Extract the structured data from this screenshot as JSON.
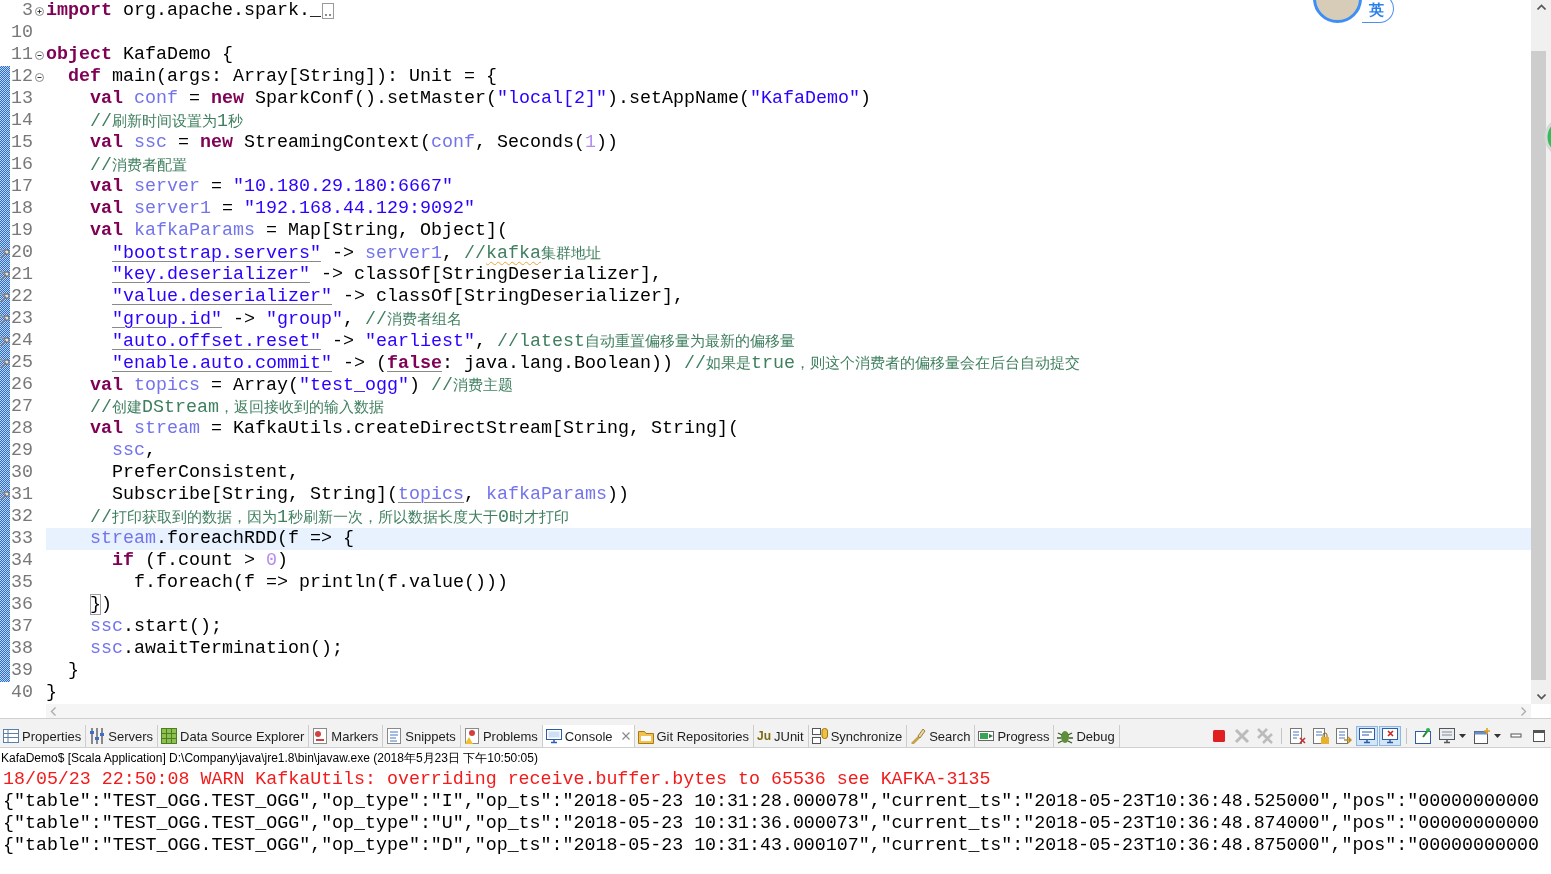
{
  "editor": {
    "lines": [
      {
        "number": "3",
        "foldable": true,
        "collapsed": true,
        "changed": false,
        "marker": false,
        "current": false,
        "tokens": [
          {
            "kind": "keyword",
            "text": "import"
          },
          {
            "kind": "plain",
            "text": " org.apache.spark._"
          }
        ]
      },
      {
        "number": "10",
        "foldable": false,
        "collapsed": false,
        "changed": false,
        "marker": false,
        "current": false
      },
      {
        "number": "11",
        "foldable": true,
        "collapsed": false,
        "changed": false,
        "marker": false,
        "current": false,
        "tokens": [
          {
            "kind": "keyword",
            "text": "object"
          },
          {
            "kind": "plain",
            "text": " KafaDemo {"
          }
        ]
      },
      {
        "number": "12",
        "foldable": true,
        "collapsed": false,
        "changed": true,
        "marker": false,
        "current": false,
        "tokens": [
          {
            "kind": "keyword",
            "text": "  def"
          },
          {
            "kind": "plain",
            "text": " main(args: Array[String]): Unit = {"
          }
        ]
      },
      {
        "number": "13",
        "foldable": false,
        "collapsed": false,
        "changed": true,
        "marker": false,
        "current": false,
        "tokens": [
          {
            "kind": "keyword",
            "text": "    val "
          },
          {
            "kind": "field",
            "text": "conf"
          },
          {
            "kind": "plain",
            "text": " = "
          },
          {
            "kind": "keyword",
            "text": "new"
          },
          {
            "kind": "plain",
            "text": " SparkConf().setMaster("
          },
          {
            "kind": "string",
            "text": "\"local[2]\""
          },
          {
            "kind": "plain",
            "text": ").setAppName("
          },
          {
            "kind": "string",
            "text": "\"KafaDemo\""
          },
          {
            "kind": "plain",
            "text": ")"
          }
        ]
      },
      {
        "number": "14",
        "foldable": false,
        "collapsed": false,
        "changed": true,
        "marker": false,
        "current": false,
        "tokens": [
          {
            "kind": "comment",
            "text": "    //刷新时间设置为1秒"
          }
        ]
      },
      {
        "number": "15",
        "foldable": false,
        "collapsed": false,
        "changed": true,
        "marker": false,
        "current": false,
        "tokens": [
          {
            "kind": "keyword",
            "text": "    val "
          },
          {
            "kind": "field",
            "text": "ssc"
          },
          {
            "kind": "plain",
            "text": " = "
          },
          {
            "kind": "keyword",
            "text": "new"
          },
          {
            "kind": "plain",
            "text": " StreamingContext("
          },
          {
            "kind": "field",
            "text": "conf"
          },
          {
            "kind": "plain",
            "text": ", Seconds("
          },
          {
            "kind": "number",
            "text": "1"
          },
          {
            "kind": "plain",
            "text": "))"
          }
        ]
      },
      {
        "number": "16",
        "foldable": false,
        "collapsed": false,
        "changed": true,
        "marker": false,
        "current": false,
        "tokens": [
          {
            "kind": "comment",
            "text": "    //消费者配置"
          }
        ]
      },
      {
        "number": "17",
        "foldable": false,
        "collapsed": false,
        "changed": true,
        "marker": false,
        "current": false,
        "tokens": [
          {
            "kind": "keyword",
            "text": "    val "
          },
          {
            "kind": "field",
            "text": "server"
          },
          {
            "kind": "plain",
            "text": " = "
          },
          {
            "kind": "string",
            "text": "\"10.180.29.180:6667\""
          }
        ]
      },
      {
        "number": "18",
        "foldable": false,
        "collapsed": false,
        "changed": true,
        "marker": false,
        "current": false,
        "tokens": [
          {
            "kind": "keyword",
            "text": "    val "
          },
          {
            "kind": "field",
            "text": "server1"
          },
          {
            "kind": "plain",
            "text": " = "
          },
          {
            "kind": "string",
            "text": "\"192.168.44.129:9092\""
          }
        ]
      },
      {
        "number": "19",
        "foldable": false,
        "collapsed": false,
        "changed": true,
        "marker": false,
        "current": false,
        "tokens": [
          {
            "kind": "keyword",
            "text": "    val "
          },
          {
            "kind": "field",
            "text": "kafkaParams"
          },
          {
            "kind": "plain",
            "text": " = Map[String, Object]("
          }
        ]
      },
      {
        "number": "20",
        "foldable": false,
        "collapsed": false,
        "changed": true,
        "marker": true,
        "current": false,
        "tokens": [
          {
            "kind": "implicit",
            "tokens": [
              {
                "kind": "string",
                "text": "      \"bootstrap.servers\""
              }
            ]
          },
          {
            "kind": "plain",
            "text": " -> "
          },
          {
            "kind": "field",
            "text": "server1"
          },
          {
            "kind": "plain",
            "text": ", "
          },
          {
            "kind": "comment",
            "text": "//"
          },
          {
            "kind": "misspelled",
            "tokens": [
              {
                "kind": "comment",
                "text": "kafka"
              }
            ]
          },
          {
            "kind": "comment",
            "text": "集群地址"
          }
        ]
      },
      {
        "number": "21",
        "foldable": false,
        "collapsed": false,
        "changed": true,
        "marker": true,
        "current": false,
        "tokens": [
          {
            "kind": "implicit",
            "tokens": [
              {
                "kind": "string",
                "text": "      \"key.deserializer\""
              }
            ]
          },
          {
            "kind": "plain",
            "text": " -> classOf[StringDeserializer],"
          }
        ]
      },
      {
        "number": "22",
        "foldable": false,
        "collapsed": false,
        "changed": true,
        "marker": true,
        "current": false,
        "tokens": [
          {
            "kind": "implicit",
            "tokens": [
              {
                "kind": "string",
                "text": "      \"value.deserializer\""
              }
            ]
          },
          {
            "kind": "plain",
            "text": " -> classOf[StringDeserializer],"
          }
        ]
      },
      {
        "number": "23",
        "foldable": false,
        "collapsed": false,
        "changed": true,
        "marker": true,
        "current": false,
        "tokens": [
          {
            "kind": "implicit",
            "tokens": [
              {
                "kind": "string",
                "text": "      \"group.id\""
              }
            ]
          },
          {
            "kind": "plain",
            "text": " -> "
          },
          {
            "kind": "string",
            "text": "\"group\""
          },
          {
            "kind": "plain",
            "text": ", "
          },
          {
            "kind": "comment",
            "text": "//消费者组名"
          }
        ]
      },
      {
        "number": "24",
        "foldable": false,
        "collapsed": false,
        "changed": true,
        "marker": true,
        "current": false,
        "tokens": [
          {
            "kind": "implicit",
            "tokens": [
              {
                "kind": "string",
                "text": "      \"auto.offset.reset\""
              }
            ]
          },
          {
            "kind": "plain",
            "text": " -> "
          },
          {
            "kind": "string",
            "text": "\"earliest\""
          },
          {
            "kind": "plain",
            "text": ", "
          },
          {
            "kind": "comment",
            "text": "//latest自动重置偏移量为最新的偏移量"
          }
        ]
      },
      {
        "number": "25",
        "foldable": false,
        "collapsed": false,
        "changed": true,
        "marker": true,
        "current": false,
        "tokens": [
          {
            "kind": "implicit",
            "tokens": [
              {
                "kind": "string",
                "text": "      \"enable.auto.commit\""
              }
            ]
          },
          {
            "kind": "plain",
            "text": " -> ("
          },
          {
            "kind": "implicit",
            "tokens": [
              {
                "kind": "keyword",
                "text": "false"
              }
            ]
          },
          {
            "kind": "plain",
            "text": ": java.lang.Boolean)) "
          },
          {
            "kind": "comment",
            "text": "//如果是true，则这个消费者的偏移量会在后台自动提交"
          }
        ]
      },
      {
        "number": "26",
        "foldable": false,
        "collapsed": false,
        "changed": true,
        "marker": false,
        "current": false,
        "tokens": [
          {
            "kind": "keyword",
            "text": "    val "
          },
          {
            "kind": "field",
            "text": "topics"
          },
          {
            "kind": "plain",
            "text": " = Array("
          },
          {
            "kind": "string",
            "text": "\"test_ogg\""
          },
          {
            "kind": "plain",
            "text": ") "
          },
          {
            "kind": "comment",
            "text": "//消费主题"
          }
        ]
      },
      {
        "number": "27",
        "foldable": false,
        "collapsed": false,
        "changed": true,
        "marker": false,
        "current": false,
        "tokens": [
          {
            "kind": "comment",
            "text": "    //创建DStream，返回接收到的输入数据"
          }
        ]
      },
      {
        "number": "28",
        "foldable": false,
        "collapsed": false,
        "changed": true,
        "marker": false,
        "current": false,
        "tokens": [
          {
            "kind": "keyword",
            "text": "    val "
          },
          {
            "kind": "field",
            "text": "stream"
          },
          {
            "kind": "plain",
            "text": " = KafkaUtils.createDirectStream[String, String]("
          }
        ]
      },
      {
        "number": "29",
        "foldable": false,
        "collapsed": false,
        "changed": true,
        "marker": false,
        "current": false,
        "tokens": [
          {
            "kind": "field",
            "text": "      ssc"
          },
          {
            "kind": "plain",
            "text": ","
          }
        ]
      },
      {
        "number": "30",
        "foldable": false,
        "collapsed": false,
        "changed": true,
        "marker": false,
        "current": false,
        "tokens": [
          {
            "kind": "plain",
            "text": "      PreferConsistent,"
          }
        ]
      },
      {
        "number": "31",
        "foldable": false,
        "collapsed": false,
        "changed": true,
        "marker": true,
        "current": false,
        "tokens": [
          {
            "kind": "plain",
            "text": "      Subscribe[String, String]("
          },
          {
            "kind": "implicit",
            "tokens": [
              {
                "kind": "field",
                "text": "topics"
              }
            ]
          },
          {
            "kind": "plain",
            "text": ", "
          },
          {
            "kind": "field",
            "text": "kafkaParams"
          },
          {
            "kind": "plain",
            "text": "))"
          }
        ]
      },
      {
        "number": "32",
        "foldable": false,
        "collapsed": false,
        "changed": true,
        "marker": false,
        "current": false,
        "tokens": [
          {
            "kind": "comment",
            "text": "    //打印获取到的数据，因为1秒刷新一次，所以数据长度大于0时才打印"
          }
        ]
      },
      {
        "number": "33",
        "foldable": false,
        "collapsed": false,
        "changed": true,
        "marker": false,
        "current": true,
        "tokens": [
          {
            "kind": "field",
            "text": "    stream"
          },
          {
            "kind": "plain",
            "text": ".foreachRDD(f => {"
          }
        ]
      },
      {
        "number": "34",
        "foldable": false,
        "collapsed": false,
        "changed": true,
        "marker": false,
        "current": false,
        "tokens": [
          {
            "kind": "keyword",
            "text": "      if"
          },
          {
            "kind": "plain",
            "text": " (f.count > "
          },
          {
            "kind": "number",
            "text": "0"
          },
          {
            "kind": "plain",
            "text": ")"
          }
        ]
      },
      {
        "number": "35",
        "foldable": false,
        "collapsed": false,
        "changed": true,
        "marker": false,
        "current": false,
        "tokens": [
          {
            "kind": "plain",
            "text": "        f.foreach(f => println(f.value()))"
          }
        ]
      },
      {
        "number": "36",
        "foldable": false,
        "collapsed": false,
        "changed": true,
        "marker": false,
        "current": false,
        "tokens": [
          {
            "kind": "match",
            "tokens": [
              {
                "kind": "plain",
                "text": "    }"
              }
            ]
          },
          {
            "kind": "plain",
            "text": ")"
          }
        ]
      },
      {
        "number": "37",
        "foldable": false,
        "collapsed": false,
        "changed": true,
        "marker": false,
        "current": false,
        "tokens": [
          {
            "kind": "field",
            "text": "    ssc"
          },
          {
            "kind": "plain",
            "text": ".start();"
          }
        ]
      },
      {
        "number": "38",
        "foldable": false,
        "collapsed": false,
        "changed": true,
        "marker": false,
        "current": false,
        "tokens": [
          {
            "kind": "field",
            "text": "    ssc"
          },
          {
            "kind": "plain",
            "text": ".awaitTermination();"
          }
        ]
      },
      {
        "number": "39",
        "foldable": false,
        "collapsed": false,
        "changed": true,
        "marker": false,
        "current": false,
        "tokens": [
          {
            "kind": "plain",
            "text": "  }"
          }
        ]
      },
      {
        "number": "40",
        "foldable": false,
        "collapsed": false,
        "changed": false,
        "marker": false,
        "current": false,
        "tokens": [
          {
            "kind": "plain",
            "text": "}"
          }
        ]
      }
    ]
  },
  "ime_indicator": {
    "label": "英"
  },
  "panel": {
    "tabs": [
      {
        "label": "Properties",
        "selected": false
      },
      {
        "label": "Servers",
        "selected": false
      },
      {
        "label": "Data Source Explorer",
        "selected": false
      },
      {
        "label": "Markers",
        "selected": false
      },
      {
        "label": "Snippets",
        "selected": false
      },
      {
        "label": "Problems",
        "selected": false
      },
      {
        "label": "Console",
        "selected": true
      },
      {
        "label": "Git Repositories",
        "selected": false
      },
      {
        "label": "JUnit",
        "selected": false,
        "icon_text": "Ju"
      },
      {
        "label": "Synchronize",
        "selected": false
      },
      {
        "label": "Search",
        "selected": false
      },
      {
        "label": "Progress",
        "selected": false
      },
      {
        "label": "Debug",
        "selected": false
      }
    ],
    "toolbar": [
      {
        "disabled": false,
        "pressed": false
      },
      {
        "disabled": true,
        "pressed": false
      },
      {
        "disabled": true,
        "pressed": false
      },
      {
        "disabled": false,
        "pressed": false
      },
      {
        "disabled": false,
        "pressed": false
      },
      {
        "disabled": false,
        "pressed": false
      },
      {
        "disabled": false,
        "pressed": true
      },
      {
        "disabled": false,
        "pressed": true
      },
      {
        "disabled": false,
        "pressed": false
      },
      {
        "disabled": false,
        "pressed": false
      },
      {
        "disabled": false,
        "pressed": false
      }
    ]
  },
  "console": {
    "header": "KafaDemo$ [Scala Application] D:\\Company\\java\\jre1.8\\bin\\javaw.exe (2018年5月23日 下午10:50:05)",
    "lines": [
      {
        "kind": "stderr",
        "text": "18/05/23 22:50:08 WARN KafkaUtils: overriding receive.buffer.bytes to 65536 see KAFKA-3135"
      },
      {
        "kind": "stdout",
        "text": "{\"table\":\"TEST_OGG.TEST_OGG\",\"op_type\":\"I\",\"op_ts\":\"2018-05-23 10:31:28.000078\",\"current_ts\":\"2018-05-23T10:36:48.525000\",\"pos\":\"00000000000"
      },
      {
        "kind": "stdout",
        "text": "{\"table\":\"TEST_OGG.TEST_OGG\",\"op_type\":\"U\",\"op_ts\":\"2018-05-23 10:31:36.000073\",\"current_ts\":\"2018-05-23T10:36:48.874000\",\"pos\":\"00000000000"
      },
      {
        "kind": "stdout",
        "text": "{\"table\":\"TEST_OGG.TEST_OGG\",\"op_type\":\"D\",\"op_ts\":\"2018-05-23 10:31:43.000107\",\"current_ts\":\"2018-05-23T10:36:48.875000\",\"pos\":\"00000000000"
      }
    ]
  }
}
